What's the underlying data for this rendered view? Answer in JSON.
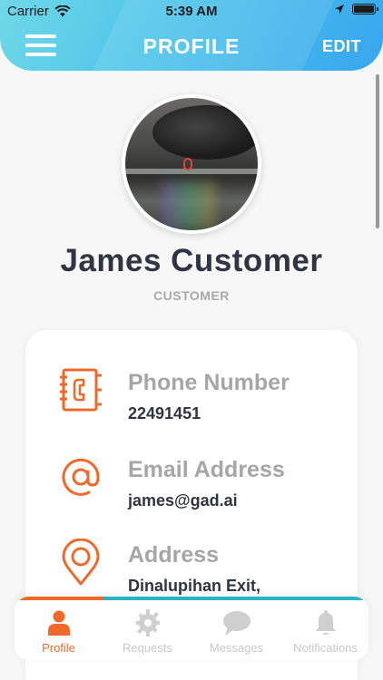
{
  "status_bar": {
    "carrier": "Carrier",
    "time": "5:39 AM"
  },
  "header": {
    "title": "PROFILE",
    "edit_label": "EDIT"
  },
  "profile": {
    "name": "James Customer",
    "role": "CUSTOMER"
  },
  "info": {
    "phone": {
      "label": "Phone Number",
      "value": "22491451",
      "icon": "phone-book-icon"
    },
    "email": {
      "label": "Email Address",
      "value": "james@gad.ai",
      "icon": "at-sign-icon"
    },
    "address": {
      "label": "Address",
      "value": "Dinalupihan Exit,",
      "icon": "map-pin-icon"
    }
  },
  "tabs": [
    {
      "label": "Profile",
      "icon": "person-icon",
      "active": true
    },
    {
      "label": "Requests",
      "icon": "gear-icon",
      "active": false
    },
    {
      "label": "Messages",
      "icon": "chat-bubble-icon",
      "active": false
    },
    {
      "label": "Notifications",
      "icon": "bell-icon",
      "active": false
    }
  ],
  "colors": {
    "accent": "#ef6a2a",
    "header_start": "#6fd8e8",
    "header_end": "#38a6ee",
    "tab_bar_line": "#2ab4c0",
    "text_dark": "#2f3542",
    "text_muted": "#a6a6a6"
  }
}
